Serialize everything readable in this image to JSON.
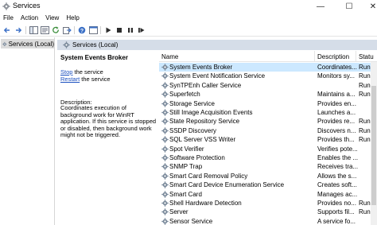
{
  "window": {
    "title": "Services",
    "min_glyph": "—",
    "max_glyph": "☐",
    "close_glyph": "✕"
  },
  "menu": [
    "File",
    "Action",
    "View",
    "Help"
  ],
  "toolbar": [
    "back-icon",
    "forward-icon",
    "show-hide-tree-icon",
    "properties-icon",
    "refresh-icon",
    "export-icon",
    "help-icon",
    "console-icon",
    "play-icon",
    "stop-icon",
    "pause-icon",
    "restart-icon"
  ],
  "tree": {
    "label": "Services (Local)"
  },
  "panel": {
    "title": "Services (Local)"
  },
  "details": {
    "service_name": "System Events Broker",
    "stop_link": "Stop",
    "stop_rest": " the service",
    "restart_link": "Restart",
    "restart_rest": " the service",
    "description_label": "Description:",
    "description": "Coordinates execution of background work for WinRT application. If this service is stopped or disabled, then background work might not be triggered."
  },
  "columns": {
    "name": "Name",
    "description": "Description",
    "status": "Statu"
  },
  "services": [
    {
      "name": "System Events Broker",
      "description": "Coordinates...",
      "status": "Runn",
      "selected": true
    },
    {
      "name": "System Event Notification Service",
      "description": "Monitors sy...",
      "status": "Runn"
    },
    {
      "name": "SynTPEnh Caller Service",
      "description": "",
      "status": "Runn"
    },
    {
      "name": "Superfetch",
      "description": "Maintains a...",
      "status": "Runn"
    },
    {
      "name": "Storage Service",
      "description": "Provides en...",
      "status": ""
    },
    {
      "name": "Still Image Acquisition Events",
      "description": "Launches a...",
      "status": ""
    },
    {
      "name": "State Repository Service",
      "description": "Provides re...",
      "status": "Runn"
    },
    {
      "name": "SSDP Discovery",
      "description": "Discovers n...",
      "status": "Runn"
    },
    {
      "name": "SQL Server VSS Writer",
      "description": "Provides th...",
      "status": "Runn"
    },
    {
      "name": "Spot Verifier",
      "description": "Verifies pote...",
      "status": ""
    },
    {
      "name": "Software Protection",
      "description": "Enables the ...",
      "status": ""
    },
    {
      "name": "SNMP Trap",
      "description": "Receives tra...",
      "status": ""
    },
    {
      "name": "Smart Card Removal Policy",
      "description": "Allows the s...",
      "status": ""
    },
    {
      "name": "Smart Card Device Enumeration Service",
      "description": "Creates soft...",
      "status": ""
    },
    {
      "name": "Smart Card",
      "description": "Manages ac...",
      "status": ""
    },
    {
      "name": "Shell Hardware Detection",
      "description": "Provides no...",
      "status": "Runn"
    },
    {
      "name": "Server",
      "description": "Supports fil...",
      "status": "Runn"
    },
    {
      "name": "Sensor Service",
      "description": "A service fo...",
      "status": ""
    }
  ]
}
